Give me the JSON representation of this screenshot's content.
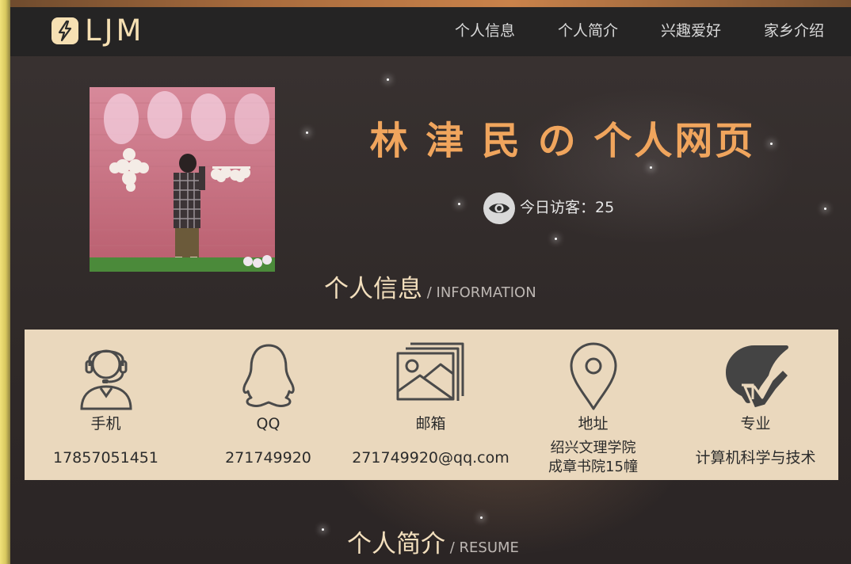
{
  "brand": {
    "logo_text": "LJM",
    "logo_icon": "lightning-icon"
  },
  "nav": {
    "items": [
      {
        "label": "个人信息"
      },
      {
        "label": "个人简介"
      },
      {
        "label": "兴趣爱好"
      },
      {
        "label": "家乡介绍"
      }
    ]
  },
  "hero": {
    "title": "林 津 民 の 个人网页",
    "visitor_icon": "eye-icon",
    "visitor_text": "今日访客：25"
  },
  "info_section": {
    "title": "个人信息",
    "subtitle": " / INFORMATION",
    "items": [
      {
        "icon": "headset-user-icon",
        "label": "手机",
        "value": "17857051451"
      },
      {
        "icon": "qq-penguin-icon",
        "label": "QQ",
        "value": "271749920"
      },
      {
        "icon": "image-gallery-icon",
        "label": "邮箱",
        "value": "271749920@qq.com"
      },
      {
        "icon": "location-pin-icon",
        "label": "地址",
        "value_line1": "绍兴文理学院",
        "value_line2": "成章书院15幢"
      },
      {
        "icon": "graduation-cap-icon",
        "label": "专业",
        "value": "计算机科学与技术"
      }
    ]
  },
  "resume_section": {
    "title": "个人简介",
    "subtitle": " / RESUME"
  },
  "colors": {
    "navbar_bg": "#252424",
    "brand": "#f6e0b3",
    "title_accent": "#f0a55d",
    "info_panel_bg": "#ead8bd",
    "section_title": "#f3dfbd"
  }
}
